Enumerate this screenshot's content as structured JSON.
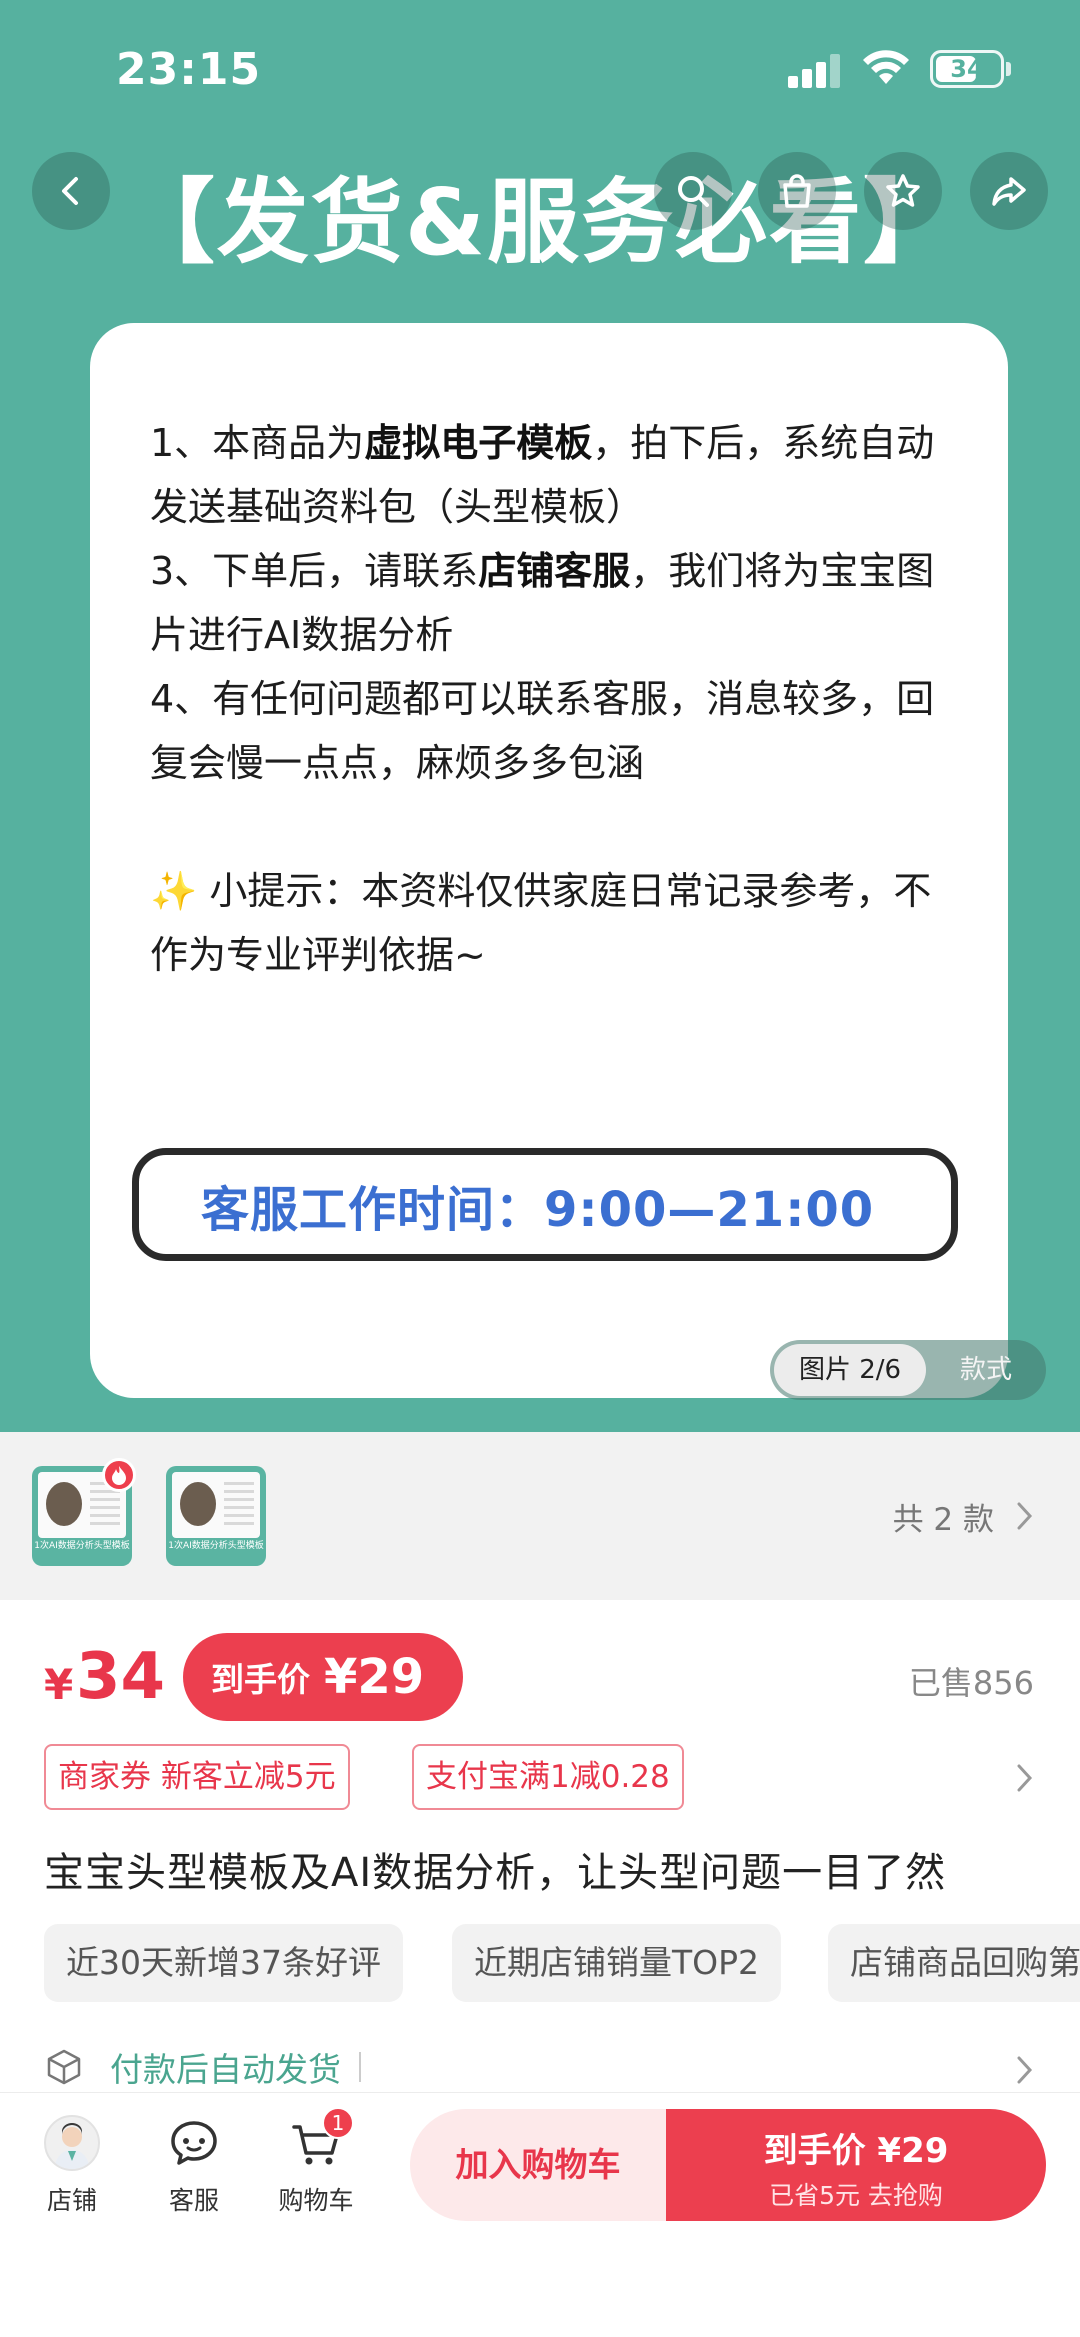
{
  "status_bar": {
    "time": "23:15",
    "battery": "34"
  },
  "hero": {
    "title": "【发货&服务必看】",
    "lines": [
      {
        "pre": "1、本商品为",
        "bold": "虚拟电子模板",
        "post": "，拍下后，系统自动发送基础资料包（头型模板）"
      },
      {
        "pre": "3、下单后，请联系",
        "bold": "店铺客服",
        "post": "，我们将为宝宝图片进行AI数据分析"
      },
      {
        "pre": "4、有任何问题都可以联系客服，消息较多，回复会慢一点点，麻烦多多包涵",
        "bold": "",
        "post": ""
      }
    ],
    "tip_icon": "✨",
    "tip": " 小提示：本资料仅供家庭日常记录参考，不作为专业评判依据~",
    "hours": "客服工作时间：9:00—21:00",
    "image_index": "图片 2/6",
    "style_tab": "款式"
  },
  "variants": {
    "thumb_caption": "1次AI数据分析头型模板",
    "count": "共 2 款"
  },
  "price": {
    "currency": "¥",
    "amount": "34",
    "final_label": "到手价",
    "final_price": "¥29",
    "sold": "已售856"
  },
  "coupons": [
    "商家券 新客立减5元",
    "支付宝满1减0.28"
  ],
  "product_title": "宝宝头型模板及AI数据分析，让头型问题一目了然",
  "tags": [
    "近30天新增37条好评",
    "近期店铺销量TOP2",
    "店铺商品回购第"
  ],
  "shipping": "付款后自动发货",
  "bottom_nav": {
    "shop": "店铺",
    "service": "客服",
    "cart": "购物车",
    "cart_count": "1",
    "add_to_cart": "加入购物车",
    "buy_main": "到手价 ¥29",
    "buy_sub": "已省5元 去抢购"
  },
  "colors": {
    "teal": "#56b19f",
    "red": "#ec3f4f",
    "hours_blue": "#3b6fd1"
  }
}
